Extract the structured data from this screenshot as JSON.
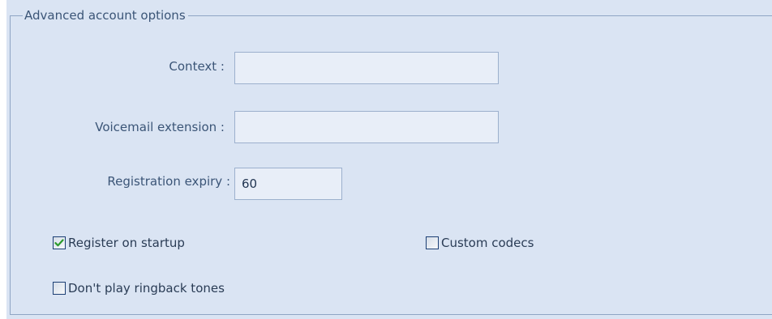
{
  "group": {
    "title": "Advanced account options"
  },
  "fields": {
    "context": {
      "label": "Context :",
      "value": ""
    },
    "voicemail": {
      "label": "Voicemail extension :",
      "value": ""
    },
    "expiry": {
      "label": "Registration expiry  :",
      "value": "60"
    }
  },
  "checkboxes": {
    "register_on_startup": {
      "label": "Register on startup",
      "checked": true
    },
    "custom_codecs": {
      "label": "Custom codecs",
      "checked": false
    },
    "no_ringback": {
      "label": "Don't play ringback tones",
      "checked": false
    }
  },
  "colors": {
    "panel_bg": "#dae4f3",
    "label_text": "#3b5577",
    "checkmark": "#2b9a2b"
  }
}
